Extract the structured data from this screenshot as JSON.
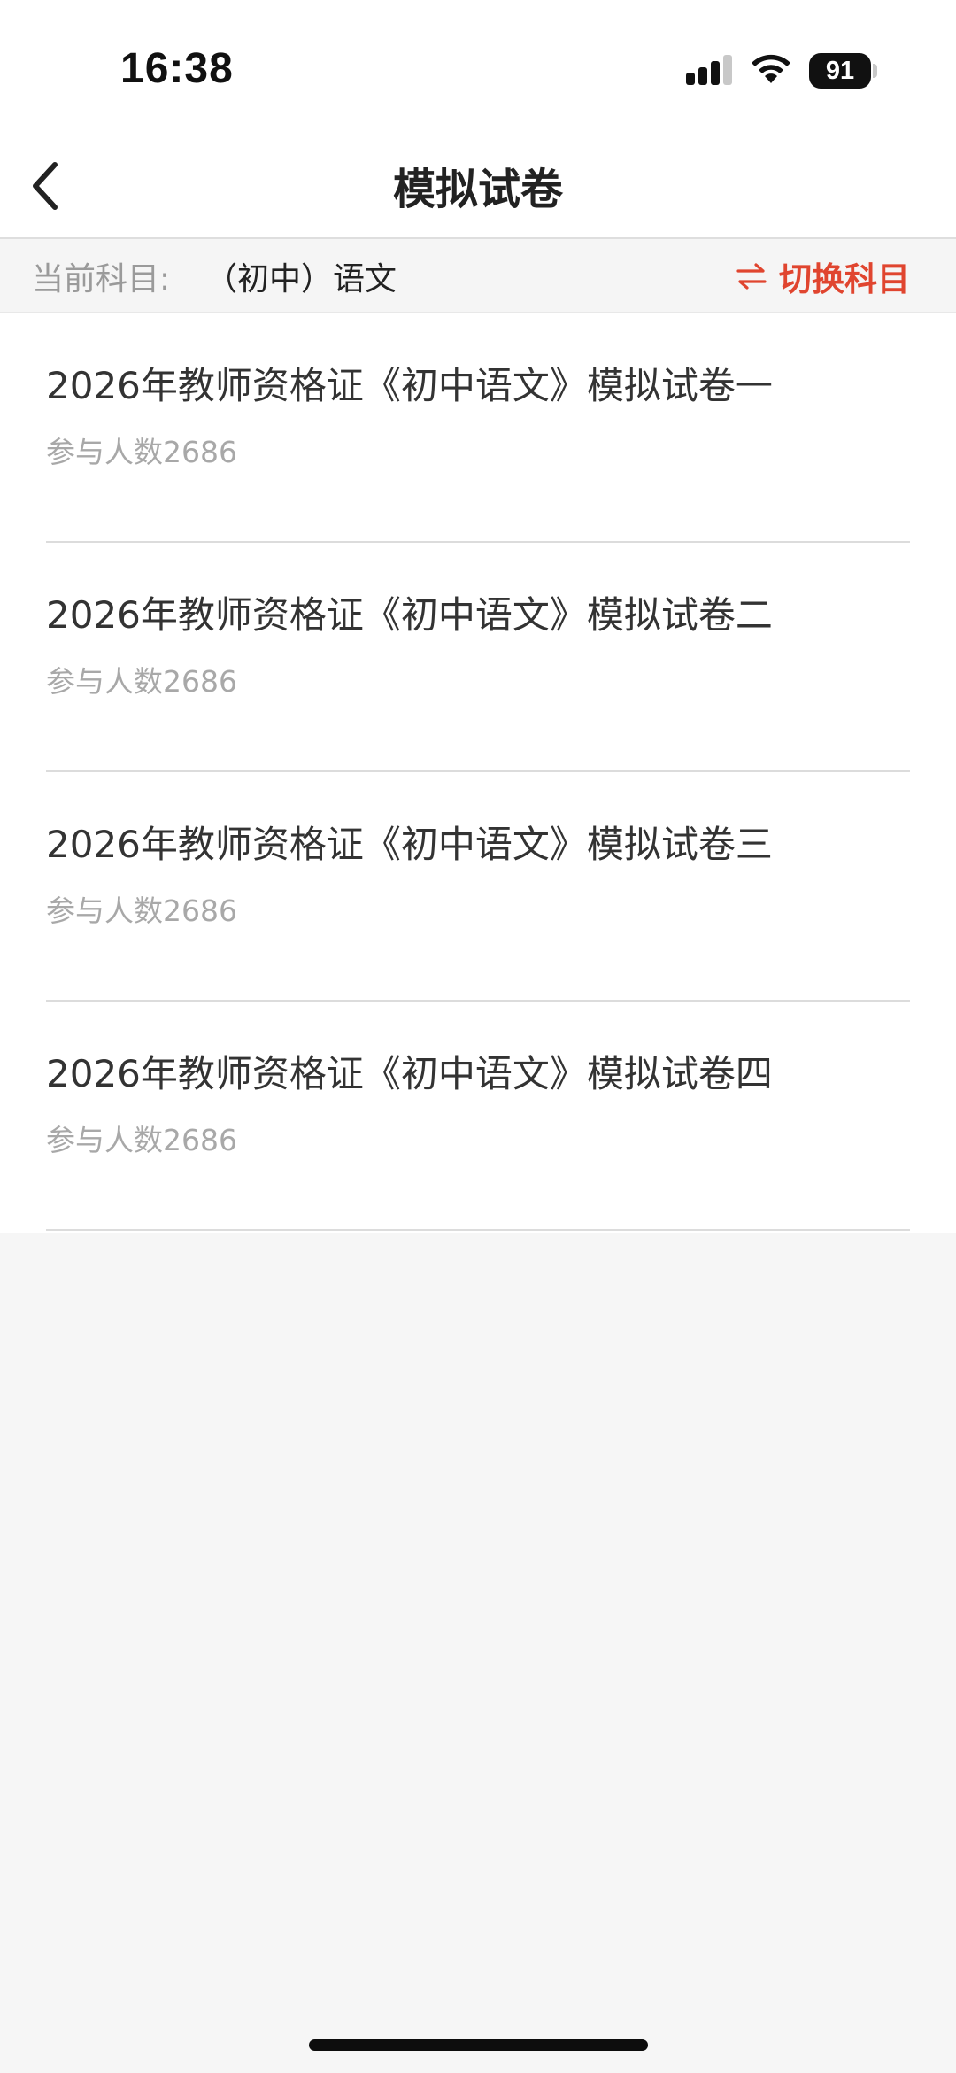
{
  "status_bar": {
    "time": "16:38",
    "battery": "91",
    "icons": [
      "signal-icon",
      "wifi-icon",
      "battery-icon"
    ]
  },
  "nav": {
    "title": "模拟试卷",
    "back_icon": "chevron-left-icon"
  },
  "subject": {
    "label": "当前科目:",
    "value": "（初中）语文",
    "switch_label": "切换科目",
    "switch_icon": "swap-arrows-icon"
  },
  "papers": [
    {
      "title": "2026年教师资格证《初中语文》模拟试卷一",
      "participants": "参与人数2686"
    },
    {
      "title": "2026年教师资格证《初中语文》模拟试卷二",
      "participants": "参与人数2686"
    },
    {
      "title": "2026年教师资格证《初中语文》模拟试卷三",
      "participants": "参与人数2686"
    },
    {
      "title": "2026年教师资格证《初中语文》模拟试卷四",
      "participants": "参与人数2686"
    }
  ],
  "colors": {
    "accent": "#e0452f",
    "text_primary": "#333333",
    "text_secondary": "#a8a8a8",
    "background": "#f6f6f6"
  }
}
